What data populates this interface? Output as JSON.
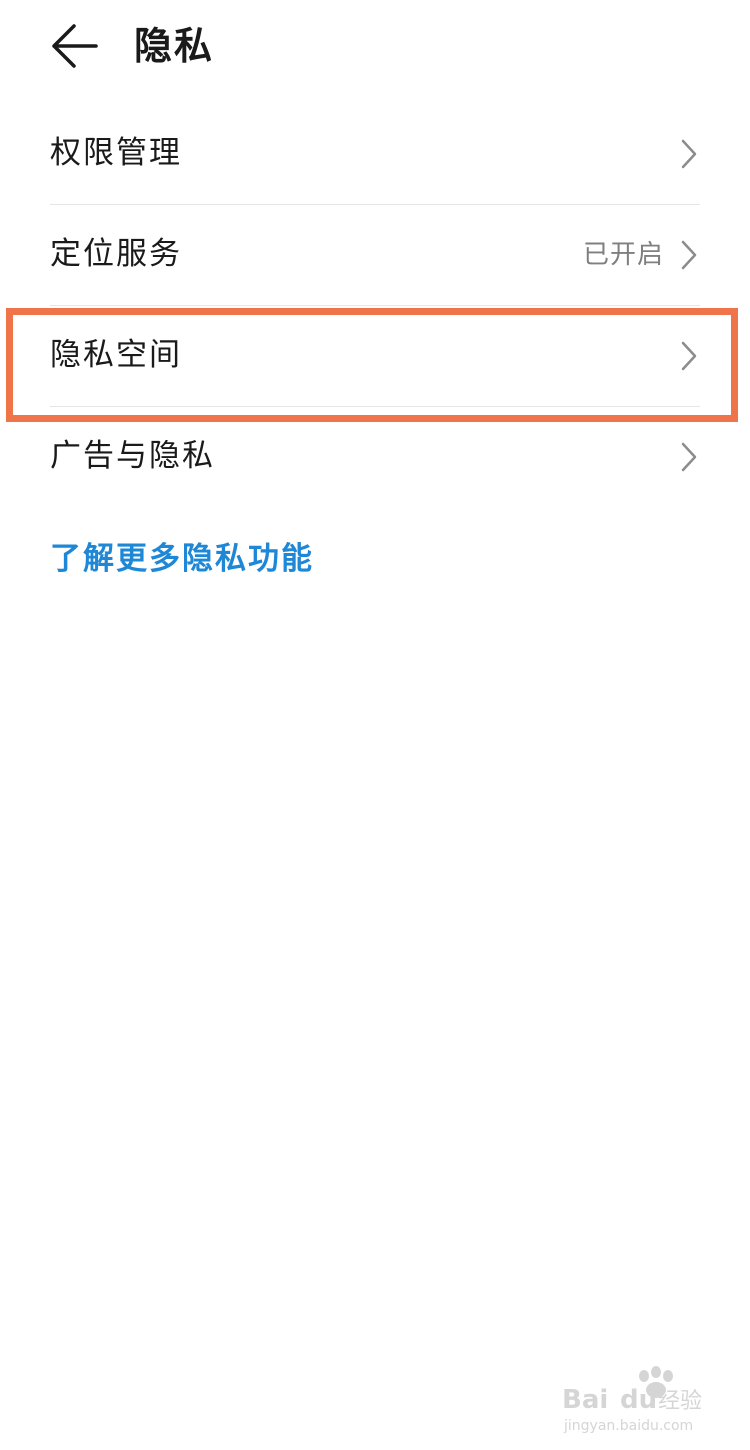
{
  "header": {
    "title": "隐私",
    "back_icon": "arrow-left-icon"
  },
  "list": {
    "items": [
      {
        "label": "权限管理",
        "value": "",
        "icon": "chevron-right-icon"
      },
      {
        "label": "定位服务",
        "value": "已开启",
        "icon": "chevron-right-icon"
      },
      {
        "label": "隐私空间",
        "value": "",
        "icon": "chevron-right-icon"
      },
      {
        "label": "广告与隐私",
        "value": "",
        "icon": "chevron-right-icon"
      }
    ]
  },
  "link": {
    "label": "了解更多隐私功能"
  },
  "watermark": {
    "brand": "Baidu经验",
    "url": "jingyan.baidu.com"
  },
  "colors": {
    "highlight": "#f0744a",
    "link": "#1f88d6",
    "text": "#1a1a1a",
    "secondary": "#7f7f7f",
    "divider": "#e6e6e6"
  }
}
